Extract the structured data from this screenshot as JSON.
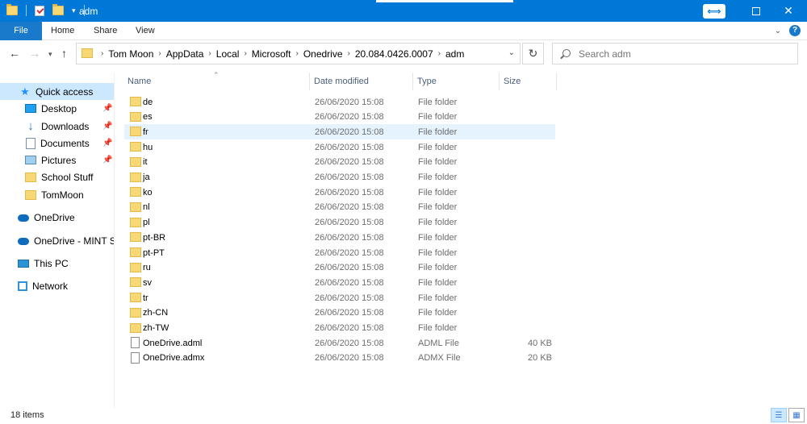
{
  "window": {
    "title": "adm"
  },
  "ribbon": {
    "tabs": [
      "File",
      "Home",
      "Share",
      "View"
    ]
  },
  "address": {
    "crumbs": [
      "Tom Moon",
      "AppData",
      "Local",
      "Microsoft",
      "Onedrive",
      "20.084.0426.0007",
      "adm"
    ]
  },
  "search": {
    "placeholder": "Search adm"
  },
  "nav": {
    "items": [
      {
        "label": "Quick access",
        "icon": "star-icon"
      },
      {
        "label": "Desktop",
        "icon": "desktop-icon",
        "pinned": true
      },
      {
        "label": "Downloads",
        "icon": "download-icon",
        "pinned": true
      },
      {
        "label": "Documents",
        "icon": "documents-icon",
        "pinned": true
      },
      {
        "label": "Pictures",
        "icon": "pictures-icon",
        "pinned": true
      },
      {
        "label": "School Stuff",
        "icon": "folder-icon"
      },
      {
        "label": "TomMoon",
        "icon": "folder-icon"
      },
      {
        "label": "OneDrive",
        "icon": "cloud-icon"
      },
      {
        "label": "OneDrive - MINT Sup",
        "icon": "cloud-icon"
      },
      {
        "label": "This PC",
        "icon": "computer-icon"
      },
      {
        "label": "Network",
        "icon": "network-icon"
      }
    ]
  },
  "columns": {
    "name": "Name",
    "date": "Date modified",
    "type": "Type",
    "size": "Size"
  },
  "files": [
    {
      "name": "de",
      "date": "26/06/2020 15:08",
      "type": "File folder",
      "size": ""
    },
    {
      "name": "es",
      "date": "26/06/2020 15:08",
      "type": "File folder",
      "size": ""
    },
    {
      "name": "fr",
      "date": "26/06/2020 15:08",
      "type": "File folder",
      "size": ""
    },
    {
      "name": "hu",
      "date": "26/06/2020 15:08",
      "type": "File folder",
      "size": ""
    },
    {
      "name": "it",
      "date": "26/06/2020 15:08",
      "type": "File folder",
      "size": ""
    },
    {
      "name": "ja",
      "date": "26/06/2020 15:08",
      "type": "File folder",
      "size": ""
    },
    {
      "name": "ko",
      "date": "26/06/2020 15:08",
      "type": "File folder",
      "size": ""
    },
    {
      "name": "nl",
      "date": "26/06/2020 15:08",
      "type": "File folder",
      "size": ""
    },
    {
      "name": "pl",
      "date": "26/06/2020 15:08",
      "type": "File folder",
      "size": ""
    },
    {
      "name": "pt-BR",
      "date": "26/06/2020 15:08",
      "type": "File folder",
      "size": ""
    },
    {
      "name": "pt-PT",
      "date": "26/06/2020 15:08",
      "type": "File folder",
      "size": ""
    },
    {
      "name": "ru",
      "date": "26/06/2020 15:08",
      "type": "File folder",
      "size": ""
    },
    {
      "name": "sv",
      "date": "26/06/2020 15:08",
      "type": "File folder",
      "size": ""
    },
    {
      "name": "tr",
      "date": "26/06/2020 15:08",
      "type": "File folder",
      "size": ""
    },
    {
      "name": "zh-CN",
      "date": "26/06/2020 15:08",
      "type": "File folder",
      "size": ""
    },
    {
      "name": "zh-TW",
      "date": "26/06/2020 15:08",
      "type": "File folder",
      "size": ""
    },
    {
      "name": "OneDrive.adml",
      "date": "26/06/2020 15:08",
      "type": "ADML File",
      "size": "40 KB"
    },
    {
      "name": "OneDrive.admx",
      "date": "26/06/2020 15:08",
      "type": "ADMX File",
      "size": "20 KB"
    }
  ],
  "status": {
    "count": "18 items"
  },
  "colors": {
    "titlebar": "#0078d7",
    "file_tab": "#1979ca",
    "selection": "#cce8ff"
  }
}
